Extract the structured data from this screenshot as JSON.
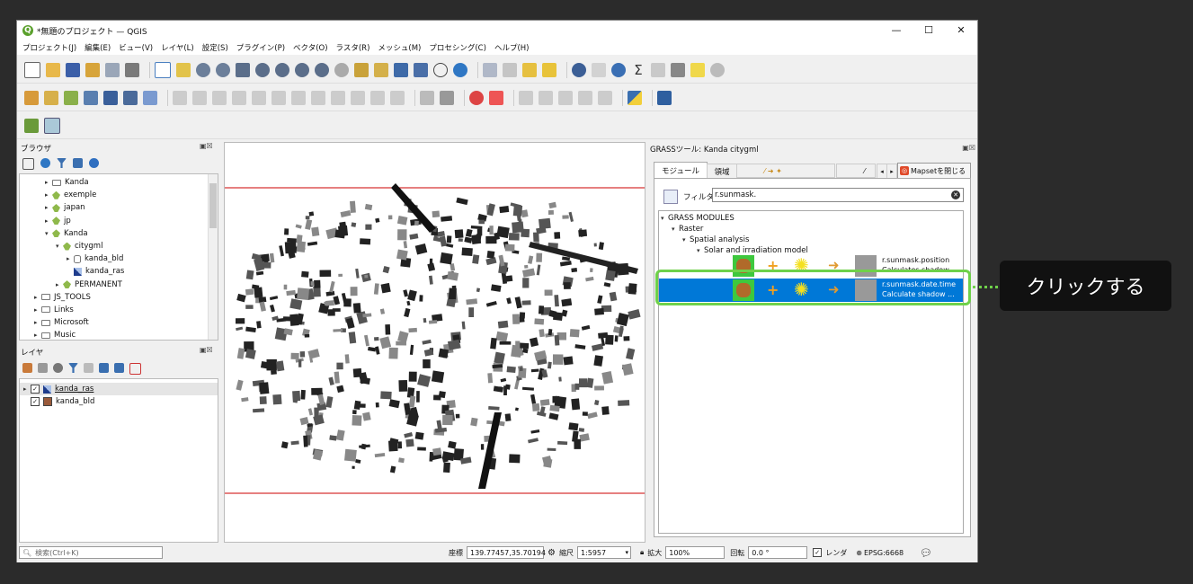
{
  "window": {
    "title": "*無題のプロジェクト — QGIS",
    "minimize": "—",
    "maximize": "☐",
    "close": "✕"
  },
  "menu": [
    "プロジェクト(J)",
    "編集(E)",
    "ビュー(V)",
    "レイヤ(L)",
    "設定(S)",
    "プラグイン(P)",
    "ベクタ(O)",
    "ラスタ(R)",
    "メッシュ(M)",
    "プロセシング(C)",
    "ヘルプ(H)"
  ],
  "browser": {
    "title": "ブラウザ",
    "items": [
      {
        "label": "Kanda",
        "type": "folder",
        "indent": 1,
        "arrow": "▸"
      },
      {
        "label": "exemple",
        "type": "grass",
        "indent": 1,
        "arrow": "▸"
      },
      {
        "label": "japan",
        "type": "grass",
        "indent": 1,
        "arrow": "▸"
      },
      {
        "label": "jp",
        "type": "grass",
        "indent": 1,
        "arrow": "▸"
      },
      {
        "label": "Kanda",
        "type": "grass",
        "indent": 1,
        "arrow": "▾"
      },
      {
        "label": "citygml",
        "type": "grass",
        "indent": 2,
        "arrow": "▾"
      },
      {
        "label": "kanda_bld",
        "type": "db",
        "indent": 3,
        "arrow": "▸"
      },
      {
        "label": "kanda_ras",
        "type": "raster",
        "indent": 3,
        "arrow": ""
      },
      {
        "label": "PERMANENT",
        "type": "grass",
        "indent": 2,
        "arrow": "▸"
      },
      {
        "label": "JS_TOOLS",
        "type": "folder",
        "indent": 0,
        "arrow": "▸"
      },
      {
        "label": "Links",
        "type": "folder",
        "indent": 0,
        "arrow": "▸"
      },
      {
        "label": "Microsoft",
        "type": "folder",
        "indent": 0,
        "arrow": "▸"
      },
      {
        "label": "Music",
        "type": "folder",
        "indent": 0,
        "arrow": "▸"
      }
    ]
  },
  "layers": {
    "title": "レイヤ",
    "items": [
      {
        "label": "kanda_ras",
        "checked": "✓"
      },
      {
        "label": "kanda_bld",
        "checked": "✓"
      }
    ]
  },
  "grass": {
    "title": "GRASSツール: Kanda citygml",
    "tab_modules": "モジュール",
    "tab_region": "領域",
    "close_mapset": "Mapsetを閉じる",
    "filter_label": "フィルタ",
    "filter_value": "r.sunmask.",
    "tree": [
      {
        "label": "GRASS MODULES",
        "indent": 0
      },
      {
        "label": "Raster",
        "indent": 1
      },
      {
        "label": "Spatial analysis",
        "indent": 2
      },
      {
        "label": "Solar and irradiation model",
        "indent": 3
      }
    ],
    "modules": [
      {
        "name": "r.sunmask.position",
        "desc": "Calculates shadow",
        "selected": false
      },
      {
        "name": "r.sunmask.date.time",
        "desc": "Calculate shadow ...",
        "selected": true
      }
    ]
  },
  "status": {
    "search_placeholder": "検索(Ctrl+K)",
    "coord_label": "座標",
    "coord_value": "139.77457,35.70194",
    "scale_label": "縮尺",
    "scale_value": "1:5957",
    "magnifier_label": "拡大",
    "magnifier_value": "100%",
    "rotation_label": "回転",
    "rotation_value": "0.0 °",
    "render_label": "レンダ",
    "crs": "EPSG:6668"
  },
  "callout": {
    "text": "クリックする",
    "accent": "#6fd14a"
  },
  "colors": {
    "selection": "#0078d7",
    "map_frame": "#cc0000",
    "highlight": "#6fd14a"
  }
}
